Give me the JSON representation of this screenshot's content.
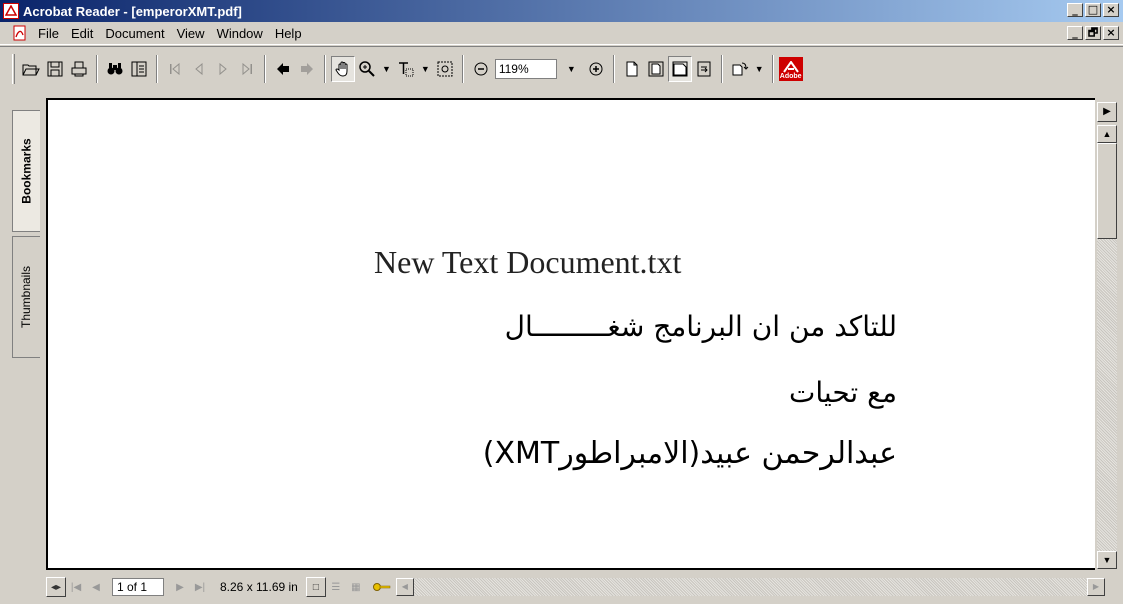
{
  "window": {
    "title": "Acrobat Reader - [emperorXMT.pdf]",
    "controls": [
      "_",
      "□",
      "×"
    ],
    "mdi_controls": [
      "_",
      "🗗",
      "×"
    ]
  },
  "menu": {
    "items": [
      "File",
      "Edit",
      "Document",
      "View",
      "Window",
      "Help"
    ]
  },
  "toolbar": {
    "zoom_value": "119%",
    "icons": [
      "open-icon",
      "save-icon",
      "print-icon",
      "find-icon",
      "show-hide-navigation-icon",
      "first-page-icon",
      "previous-page-icon",
      "next-page-icon",
      "last-page-icon",
      "go-back-icon",
      "go-forward-icon",
      "hand-tool-icon",
      "zoom-in-tool-icon",
      "text-select-icon",
      "graphics-select-icon",
      "zoom-out-icon",
      "zoom-plus-icon",
      "actual-size-icon",
      "fit-page-icon",
      "fit-width-icon",
      "reflow-icon",
      "rotate-icon",
      "adobe-logo-icon"
    ],
    "adobe_label": "Adobe"
  },
  "nav_tabs": {
    "bookmarks": "Bookmarks",
    "thumbnails": "Thumbnails"
  },
  "document": {
    "heading": "New Text Document.txt",
    "line1": "للتاكد من ان البرنامج شغـــــــــال",
    "line2": "مع تحيات",
    "line3": "عبدالرحمن عبيد(الامبراطورXMT)"
  },
  "status": {
    "page_indicator": "1 of 1",
    "page_size": "8.26 x 11.69 in"
  },
  "colors": {
    "titlebar_start": "#0a246a",
    "titlebar_end": "#a6caf0",
    "adobe_red": "#ce0000",
    "chrome": "#d4d0c8"
  }
}
